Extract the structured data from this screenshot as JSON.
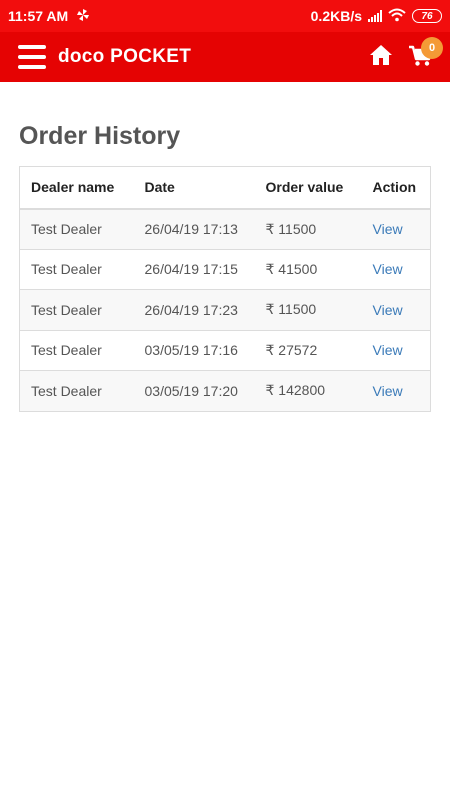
{
  "status_bar": {
    "time": "11:57 AM",
    "network_speed": "0.2KB/s",
    "battery": "76"
  },
  "app_bar": {
    "title": "doco POCKET",
    "cart_count": "0"
  },
  "page": {
    "title": "Order History"
  },
  "table": {
    "headers": [
      "Dealer name",
      "Date",
      "Order value",
      "Action"
    ],
    "rows": [
      {
        "dealer": "Test Dealer",
        "date": "26/04/19 17:13",
        "value": "₹ 11500",
        "action": "View"
      },
      {
        "dealer": "Test Dealer",
        "date": "26/04/19 17:15",
        "value": "₹ 41500",
        "action": "View"
      },
      {
        "dealer": "Test Dealer",
        "date": "26/04/19 17:23",
        "value": "₹ 11500",
        "action": "View"
      },
      {
        "dealer": "Test Dealer",
        "date": "03/05/19 17:16",
        "value": "₹ 27572",
        "action": "View"
      },
      {
        "dealer": "Test Dealer",
        "date": "03/05/19 17:20",
        "value": "₹ 142800",
        "action": "View"
      }
    ]
  },
  "colors": {
    "status_bar": "#f20d0d",
    "app_bar": "#e50303",
    "badge": "#f49a36",
    "link": "#3a7ab8"
  }
}
